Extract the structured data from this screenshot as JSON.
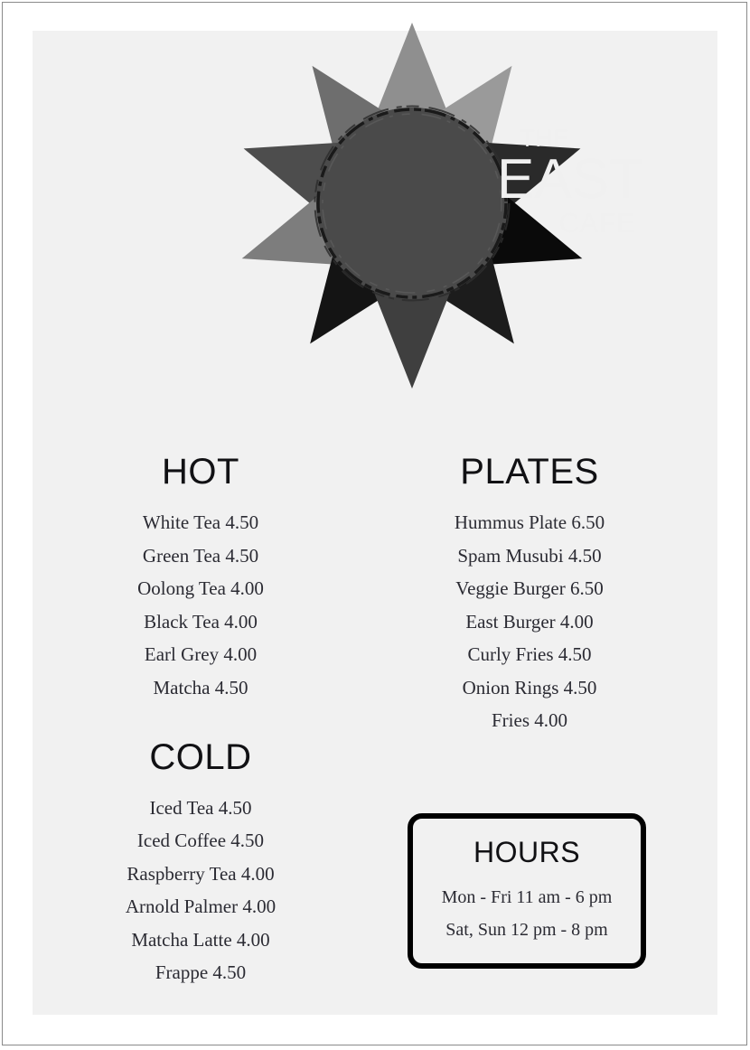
{
  "page": {
    "background_color": "#ffffff",
    "panel_color": "#f1f1f1",
    "frame_color": "#8a8a8a",
    "text_color": "#2b2b33",
    "heading_color": "#111114"
  },
  "logo": {
    "name": "the-east-cafe-logo",
    "line1": "THE",
    "line2": "EAST",
    "line3": "CAFE",
    "circle_color": "#4a4a4a",
    "text_color": "#f0f0f0",
    "leaf_colors": [
      "#8f8f8f",
      "#9a9a9a",
      "#3f3f3f",
      "#4d4d4d",
      "#0a0a0a",
      "#1c1c1c",
      "#6e6e6e",
      "#2a2a2a",
      "#7d7d7d",
      "#141414"
    ]
  },
  "menu": {
    "sections": [
      {
        "id": "hot",
        "title": "HOT",
        "items": [
          {
            "name": "White Tea",
            "price": "4.50",
            "text": "White Tea 4.50"
          },
          {
            "name": "Green Tea",
            "price": "4.50",
            "text": "Green Tea 4.50"
          },
          {
            "name": "Oolong Tea",
            "price": "4.00",
            "text": "Oolong Tea 4.00"
          },
          {
            "name": "Black Tea",
            "price": "4.00",
            "text": "Black Tea 4.00"
          },
          {
            "name": "Earl Grey",
            "price": "4.00",
            "text": "Earl Grey 4.00"
          },
          {
            "name": "Matcha",
            "price": "4.50",
            "text": "Matcha 4.50"
          }
        ]
      },
      {
        "id": "cold",
        "title": "COLD",
        "items": [
          {
            "name": "Iced Tea",
            "price": "4.50",
            "text": "Iced Tea 4.50"
          },
          {
            "name": "Iced Coffee",
            "price": "4.50",
            "text": "Iced Coffee 4.50"
          },
          {
            "name": "Raspberry Tea",
            "price": "4.00",
            "text": "Raspberry Tea 4.00"
          },
          {
            "name": "Arnold Palmer",
            "price": "4.00",
            "text": "Arnold Palmer 4.00"
          },
          {
            "name": "Matcha Latte",
            "price": "4.00",
            "text": "Matcha Latte 4.00"
          },
          {
            "name": "Frappe",
            "price": "4.50",
            "text": "Frappe 4.50"
          }
        ]
      },
      {
        "id": "plates",
        "title": "PLATES",
        "items": [
          {
            "name": "Hummus Plate",
            "price": "6.50",
            "text": "Hummus Plate 6.50"
          },
          {
            "name": "Spam Musubi",
            "price": "4.50",
            "text": "Spam Musubi 4.50"
          },
          {
            "name": "Veggie Burger",
            "price": "6.50",
            "text": "Veggie Burger 6.50"
          },
          {
            "name": "East Burger",
            "price": "4.00",
            "text": "East Burger 4.00"
          },
          {
            "name": "Curly Fries",
            "price": "4.50",
            "text": "Curly Fries 4.50"
          },
          {
            "name": "Onion Rings",
            "price": "4.50",
            "text": "Onion Rings 4.50"
          },
          {
            "name": "Fries",
            "price": "4.00",
            "text": "Fries 4.00"
          }
        ]
      }
    ]
  },
  "hours": {
    "title": "HOURS",
    "lines": [
      "Mon - Fri 11 am - 6 pm",
      "Sat, Sun 12 pm - 8 pm"
    ],
    "border_color": "#000000"
  }
}
